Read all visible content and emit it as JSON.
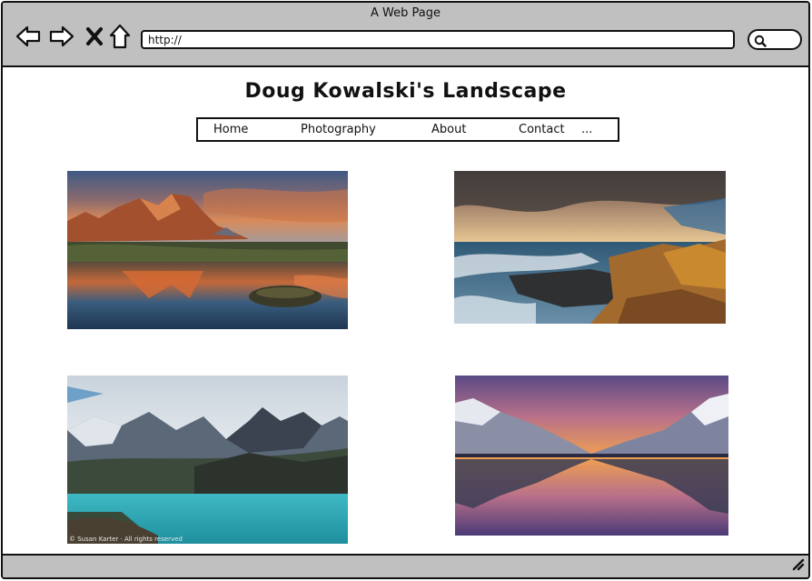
{
  "window": {
    "title": "A Web Page",
    "url": "http://"
  },
  "toolbar": {
    "icons": [
      "back-arrow-icon",
      "forward-arrow-icon",
      "close-x-icon",
      "home-icon",
      "search-icon"
    ]
  },
  "page": {
    "title": "Doug Kowalski's Landscape",
    "nav": {
      "items": [
        {
          "label": "Home"
        },
        {
          "label": "Photography"
        },
        {
          "label": "About"
        },
        {
          "label": "Contact"
        },
        {
          "label": "..."
        }
      ]
    },
    "photos": [
      {
        "subject": "mountain reflection at dusk"
      },
      {
        "subject": "rocky coastline with waves"
      },
      {
        "subject": "turquoise lake below snowy peaks",
        "credit": "© Susan Karter · All rights reserved"
      },
      {
        "subject": "fjord reflection at sunset"
      }
    ]
  },
  "colors": {
    "chrome": "#c0c0c0",
    "border": "#111111",
    "page": "#ffffff"
  }
}
